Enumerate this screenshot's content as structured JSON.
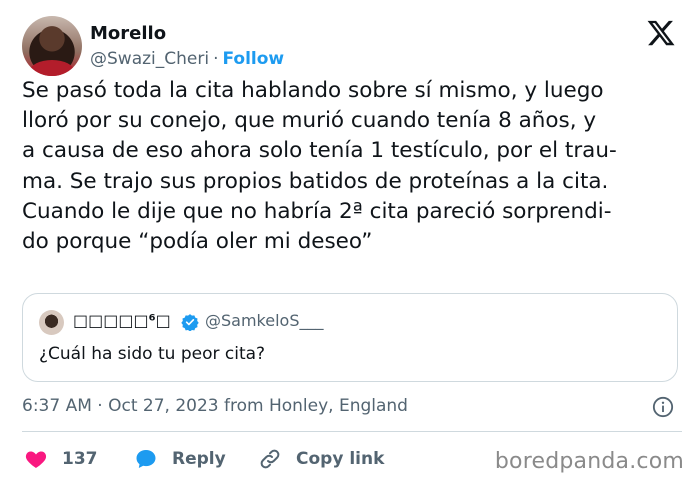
{
  "author": {
    "name": "Morello",
    "handle": "@Swazi_Cheri",
    "separator": "·",
    "follow_label": "Follow"
  },
  "tweet": {
    "lines": [
      "Se pasó toda la cita hablando sobre sí mismo, y luego",
      "lloró por su conejo, que murió cuando tenía 8 años, y",
      "a causa de eso ahora solo tenía 1 testículo, por el trau-",
      "ma. Se trajo sus propios batidos de proteínas a la cita.",
      "Cuando le dije que no habría 2ª cita pareció sorprendi-",
      "do porque “podía oler mi deseo”"
    ]
  },
  "quoted": {
    "display_name": "□□□□□⁶□",
    "handle": "@SamkeloS___",
    "text": "¿Cuál ha sido tu peor cita?"
  },
  "meta": {
    "timestamp": "6:37 AM · Oct 27, 2023 from Honley, England"
  },
  "actions": {
    "like_count": "137",
    "reply_label": "Reply",
    "copy_label": "Copy link"
  },
  "watermark": "boredpanda.com",
  "colors": {
    "accent": "#1d9bf0",
    "like": "#f91880",
    "muted": "#536471",
    "text": "#0f1419"
  },
  "icons": [
    "x-logo-icon",
    "verified-badge-icon",
    "info-icon",
    "heart-icon",
    "reply-bubble-icon",
    "link-icon"
  ]
}
